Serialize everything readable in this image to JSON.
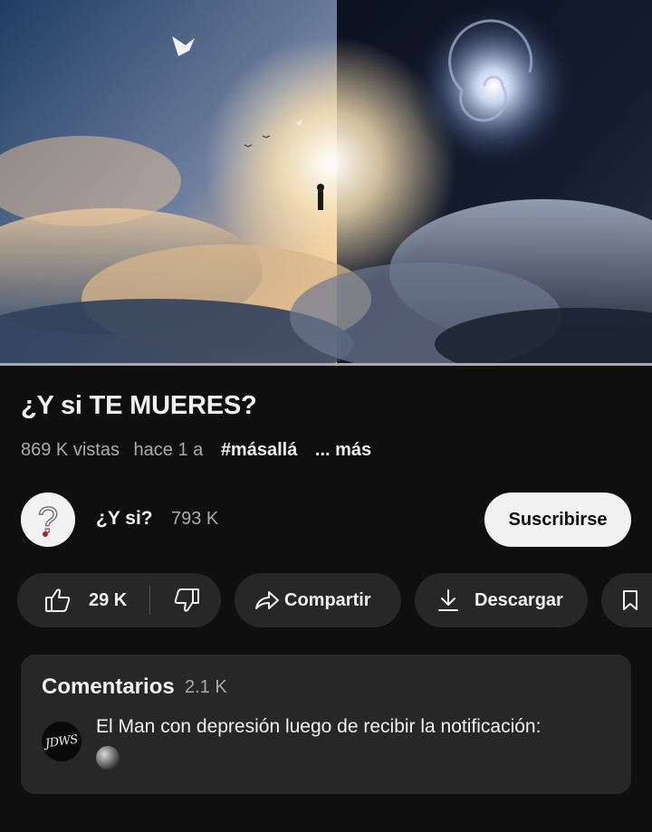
{
  "video": {
    "title": "¿Y si TE MUERES?",
    "views": "869 K vistas",
    "age": "hace 1 a",
    "hashtag": "#másallá",
    "more_label": "... más",
    "progress_fraction": 1.0
  },
  "channel": {
    "name": "¿Y si?",
    "subscribers": "793 K",
    "avatar_glyph": "?",
    "subscribe_label": "Suscribirse"
  },
  "actions": {
    "like_count": "29 K",
    "share_label": "Compartir",
    "download_label": "Descargar"
  },
  "comments": {
    "title": "Comentarios",
    "count": "2.1 K",
    "top_comment": {
      "avatar_text": "JDWS",
      "text": "El Man con depresión luego de recibir la notificación:"
    }
  },
  "colors": {
    "background": "#0f0f0f",
    "surface": "#272727",
    "text_primary": "#f1f1f1",
    "text_secondary": "#aaaaaa",
    "subscribe_bg": "#f1f1f1"
  },
  "icons": [
    "thumbs-up-icon",
    "thumbs-down-icon",
    "share-arrow-icon",
    "download-icon",
    "bookmark-icon",
    "black-circle-emoji"
  ]
}
